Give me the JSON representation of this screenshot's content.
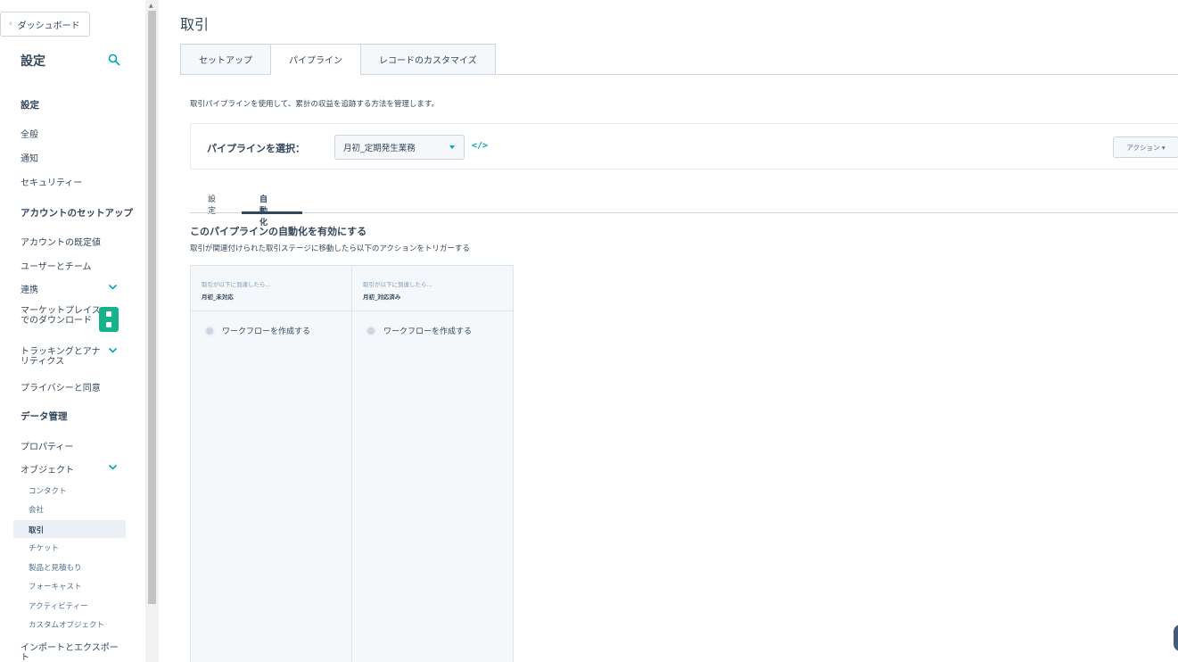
{
  "sidebar": {
    "back_label": "ダッシュボード",
    "title": "設定",
    "items": [
      {
        "label": "設定",
        "kind": "hdr"
      },
      {
        "label": "全般",
        "kind": "item"
      },
      {
        "label": "通知",
        "kind": "item"
      },
      {
        "label": "セキュリティー",
        "kind": "item"
      },
      {
        "label": "アカウントのセットアップ",
        "kind": "hdr"
      },
      {
        "label": "アカウントの既定値",
        "kind": "item"
      },
      {
        "label": "ユーザーとチーム",
        "kind": "item"
      },
      {
        "label": "連携",
        "kind": "item"
      },
      {
        "label": "マーケットプレイス\nでのダウンロード",
        "kind": "item"
      },
      {
        "label": "トラッキングとアナ\nリティクス",
        "kind": "item"
      },
      {
        "label": "プライバシーと同意",
        "kind": "item"
      },
      {
        "label": "データ管理",
        "kind": "hdr"
      },
      {
        "label": "プロパティー",
        "kind": "item"
      },
      {
        "label": "オブジェクト",
        "kind": "item"
      },
      {
        "label": "コンタクト",
        "kind": "sub"
      },
      {
        "label": "会社",
        "kind": "sub"
      },
      {
        "label": "取引",
        "kind": "sub"
      },
      {
        "label": "チケット",
        "kind": "sub"
      },
      {
        "label": "製品と見積もり",
        "kind": "sub"
      },
      {
        "label": "フォーキャスト",
        "kind": "sub"
      },
      {
        "label": "アクティビティー",
        "kind": "sub"
      },
      {
        "label": "カスタムオブジェクト",
        "kind": "sub"
      },
      {
        "label": "インポートとエクスポー\nト",
        "kind": "item"
      }
    ]
  },
  "main": {
    "title": "取引",
    "tabs": [
      {
        "label": "セットアップ"
      },
      {
        "label": "パイプライン"
      },
      {
        "label": "レコードのカスタマイズ"
      }
    ],
    "description": "取引パイプラインを使用して、累計の収益を追跡する方法を管理します。",
    "pipeline": {
      "label": "パイプラインを選択：",
      "selected": "月初_定期発生業務",
      "embed_glyph": "</>",
      "actions_label": "アクション ▾"
    },
    "subtabs": [
      {
        "label": "設定"
      },
      {
        "label": "自動化"
      }
    ],
    "automation": {
      "title": "このパイプラインの自動化を有効にする",
      "description": "取引が関連付けられた取引ステージに移動したら以下のアクションをトリガーする",
      "columns": [
        {
          "prefix": "取引が以下に到達したら...",
          "stage": "月初_未対応",
          "workflow_label": "ワークフローを作成する"
        },
        {
          "prefix": "取引が以下に到達したら...",
          "stage": "月初_対応済み",
          "workflow_label": "ワークフローを作成する"
        }
      ]
    }
  },
  "colors": {
    "accent": "#00a4bd",
    "text": "#33475b",
    "chat_green": "#16b28c"
  }
}
